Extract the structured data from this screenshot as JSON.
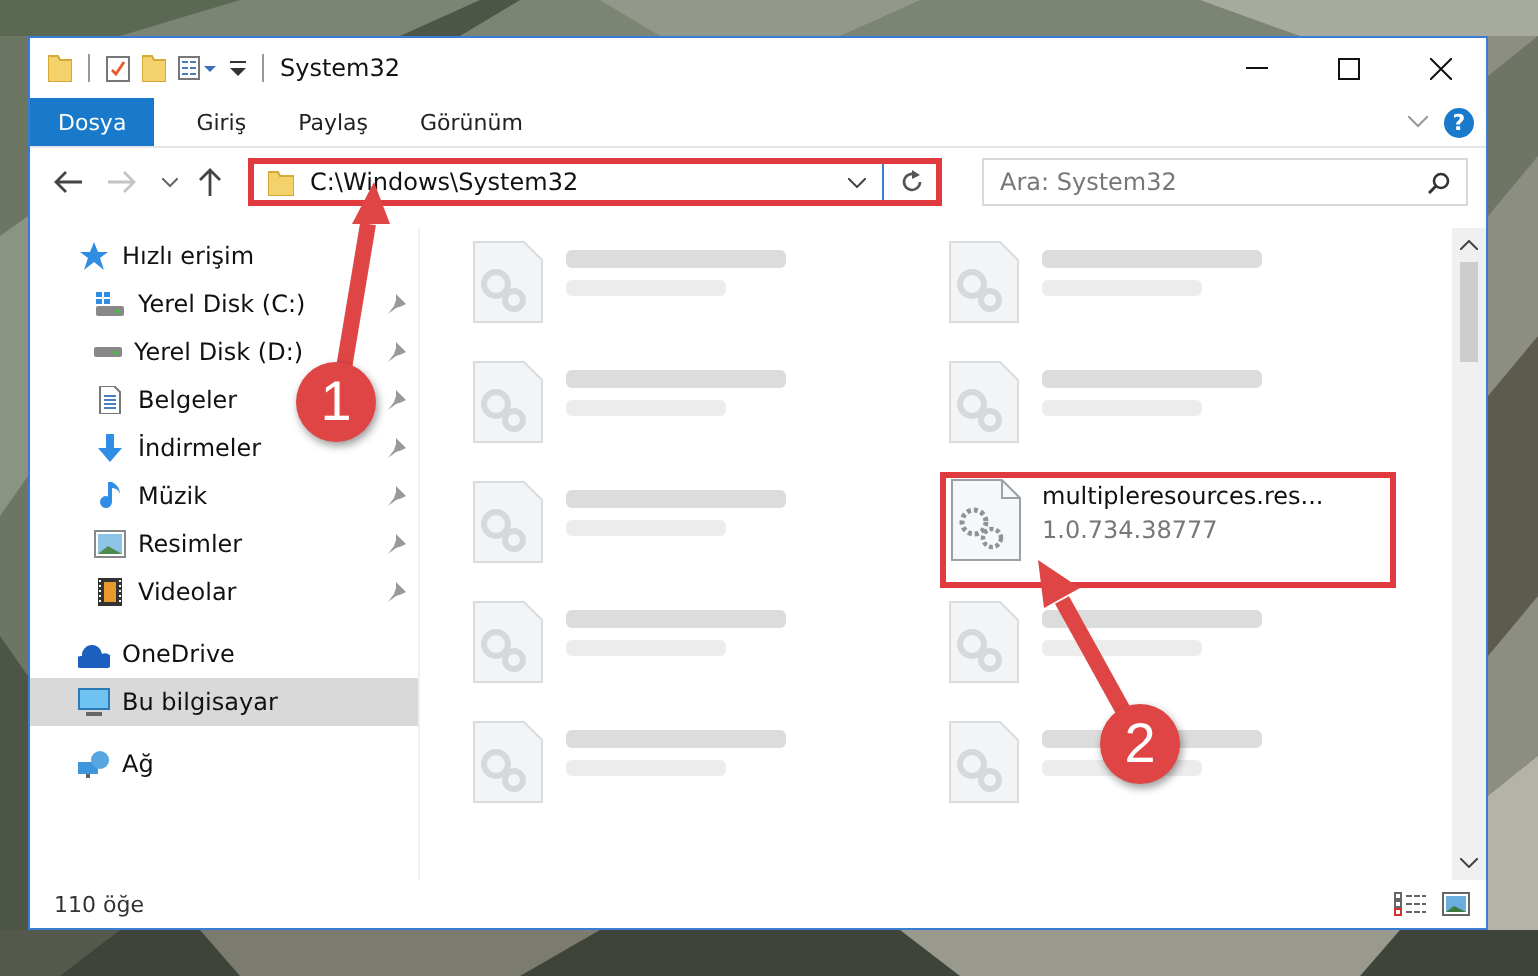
{
  "window": {
    "title": "System32"
  },
  "ribbon": {
    "tabs": [
      {
        "label": "Dosya",
        "kind": "file"
      },
      {
        "label": "Giriş",
        "kind": "tab"
      },
      {
        "label": "Paylaş",
        "kind": "tab"
      },
      {
        "label": "Görünüm",
        "kind": "tab"
      }
    ],
    "help": "?"
  },
  "address_bar": {
    "path": "C:\\Windows\\System32",
    "highlighted": true
  },
  "search": {
    "placeholder": "Ara: System32"
  },
  "navigation": [
    {
      "label": "Hızlı erişim",
      "kind": "star",
      "selected": false,
      "children": [
        {
          "label": "Yerel Disk (C:)",
          "kind": "windrive",
          "pinned": true,
          "selected": false
        },
        {
          "label": "Yerel Disk (D:)",
          "kind": "drive",
          "pinned": true,
          "selected": false
        },
        {
          "label": "Belgeler",
          "kind": "document",
          "pinned": true,
          "selected": false
        },
        {
          "label": "İndirmeler",
          "kind": "download",
          "pinned": true,
          "selected": false
        },
        {
          "label": "Müzik",
          "kind": "music",
          "pinned": true,
          "selected": false
        },
        {
          "label": "Resimler",
          "kind": "pictures",
          "pinned": true,
          "selected": false
        },
        {
          "label": "Videolar",
          "kind": "video",
          "pinned": true,
          "selected": false
        }
      ]
    },
    {
      "label": "OneDrive",
      "kind": "cloud",
      "selected": false
    },
    {
      "label": "Bu bilgisayar",
      "kind": "computer",
      "selected": true
    },
    {
      "label": "Ağ",
      "kind": "network",
      "selected": false
    }
  ],
  "files": [
    {
      "kind": "blurred",
      "highlighted": false
    },
    {
      "kind": "blurred",
      "highlighted": false
    },
    {
      "kind": "blurred",
      "highlighted": false
    },
    {
      "kind": "blurred",
      "highlighted": false
    },
    {
      "kind": "blurred",
      "highlighted": false
    },
    {
      "kind": "file",
      "name": "multipleresources.res...",
      "detail": "1.0.734.38777",
      "highlighted": true
    },
    {
      "kind": "blurred",
      "highlighted": false
    },
    {
      "kind": "blurred",
      "highlighted": false
    },
    {
      "kind": "blurred",
      "highlighted": false
    },
    {
      "kind": "blurred",
      "highlighted": false
    }
  ],
  "status_bar": {
    "count": "110 öğe"
  },
  "callouts": [
    {
      "number": "1"
    },
    {
      "number": "2"
    }
  ]
}
